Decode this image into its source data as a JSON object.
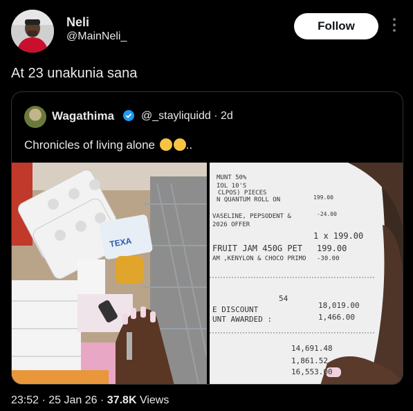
{
  "author": {
    "name": "Neli",
    "handle": "@MainNeli_"
  },
  "follow_label": "Follow",
  "tweet_text": "At 23 unakunia sana",
  "quoted": {
    "name": "Wagathima",
    "handle_time": "@_stayliquidd · 2d",
    "text": "Chronicles of living alone",
    "text_suffix": ".."
  },
  "receipt": {
    "lines": [
      "MUNT 50%",
      "IOL 10'S",
      "CLPOS) PIECES",
      "N QUANTUM ROLL ON",
      "199.00",
      "VASELINE, PEPSODENT &",
      "2026 OFFER",
      "-24.00",
      "1 x 199.00",
      "FRUIT JAM 450G PET",
      "199.00",
      "AM ,KENYLON & CHOCO PRIMO",
      "-30.00",
      "54",
      "E DISCOUNT",
      "18,019.00",
      "UNT AWARDED :",
      "1,466.00",
      "14,691.48",
      "1,861.52",
      "16,553.00"
    ]
  },
  "footer": {
    "time": "23:52",
    "date": "25 Jan 26",
    "views_count": "37.8K",
    "views_label": "Views"
  }
}
